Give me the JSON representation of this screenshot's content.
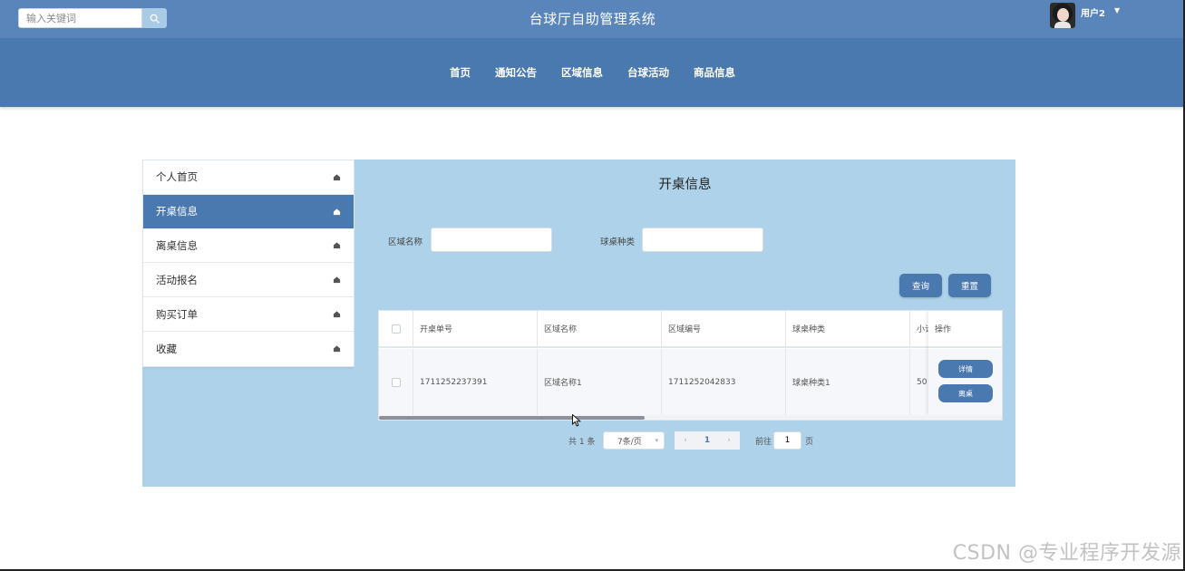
{
  "header": {
    "search_placeholder": "输入关键词",
    "site_title": "台球厅自助管理系统",
    "user_name": "用户2"
  },
  "nav": {
    "items": [
      {
        "label": "首页"
      },
      {
        "label": "通知公告"
      },
      {
        "label": "区域信息"
      },
      {
        "label": "台球活动"
      },
      {
        "label": "商品信息"
      }
    ]
  },
  "sidebar": {
    "items": [
      {
        "label": "个人首页",
        "active": false
      },
      {
        "label": "开桌信息",
        "active": true
      },
      {
        "label": "离桌信息",
        "active": false
      },
      {
        "label": "活动报名",
        "active": false
      },
      {
        "label": "购买订单",
        "active": false
      },
      {
        "label": "收藏",
        "active": false
      }
    ]
  },
  "main": {
    "title": "开桌信息",
    "filters": {
      "area_name_label": "区域名称",
      "table_type_label": "球桌种类",
      "area_name_value": "",
      "table_type_value": ""
    },
    "buttons": {
      "query": "查询",
      "reset": "重置"
    },
    "table": {
      "columns": [
        "开桌单号",
        "区域名称",
        "区域编号",
        "球桌种类",
        "小计",
        "操作"
      ],
      "rows": [
        {
          "order_no": "1711252237391",
          "area_name": "区域名称1",
          "area_no": "1711252042833",
          "table_type": "球桌种类1",
          "subtotal": "50",
          "actions": [
            "详情",
            "离桌"
          ]
        }
      ]
    },
    "pagination": {
      "total_text": "共 1 条",
      "page_size": "7条/页",
      "prev": "‹",
      "current_page": "1",
      "next": "›",
      "goto_label": "前往",
      "goto_value": "1",
      "page_unit": "页"
    }
  },
  "watermark": "CSDN @专业程序开发源",
  "colors": {
    "header_bg": "#5a85bb",
    "nav_bg": "#4a79b0",
    "content_bg": "#aed2ea",
    "accent": "#4a79b0"
  }
}
